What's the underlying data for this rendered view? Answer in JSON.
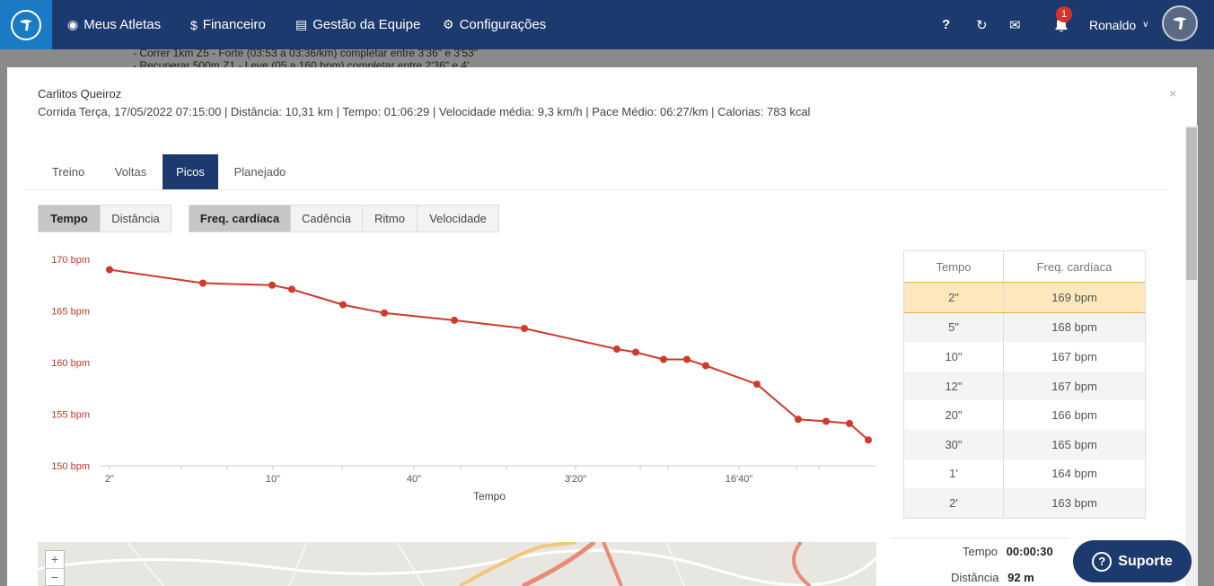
{
  "nav": {
    "items": [
      {
        "label": "Meus Atletas",
        "icon": "medal-icon"
      },
      {
        "label": "Financeiro",
        "icon": "dollar-icon"
      },
      {
        "label": "Gestão da Equipe",
        "icon": "id-card-icon"
      },
      {
        "label": "Configurações",
        "icon": "gears-icon"
      }
    ],
    "help": "?",
    "notifications": "1",
    "user": "Ronaldo"
  },
  "background_text": [
    "- Correr 1km Z5 - Forte (03:53 a 03:36/km) completar entre 3'36\" e 3'53\"",
    "- Recuperar 500m Z1 - Leve (05 a 160 bpm) completar entre 2'36\" e 4'"
  ],
  "modal": {
    "athlete": "Carlitos Queiroz",
    "summary": "Corrida Terça, 17/05/2022 07:15:00 | Distância: 10,31 km | Tempo: 01:06:29 | Velocidade média: 9,3 km/h | Pace Médio: 06:27/km | Calorias: 783 kcal",
    "close": "×",
    "tabs": [
      "Treino",
      "Voltas",
      "Picos",
      "Planejado"
    ],
    "active_tab": "Picos",
    "mode_buttons": [
      "Tempo",
      "Distância"
    ],
    "metric_buttons": [
      "Freq. cardíaca",
      "Cadência",
      "Ritmo",
      "Velocidade"
    ],
    "active_mode": "Tempo",
    "active_metric": "Freq. cardíaca"
  },
  "chart_data": {
    "type": "line",
    "xlabel": "Tempo",
    "ylabel": "",
    "y_ticks": [
      "150 bpm",
      "155 bpm",
      "160 bpm",
      "165 bpm",
      "170 bpm"
    ],
    "ylim": [
      150,
      170
    ],
    "x_tick_labels": [
      "2\"",
      "10\"",
      "40\"",
      "3'20\"",
      "16'40\""
    ],
    "series_color": "#d0392b",
    "series": [
      {
        "name": "",
        "values": [
          169,
          167.7,
          167.5,
          167.1,
          165.6,
          164.8,
          164.1,
          163.3,
          161.3,
          161.0,
          160.3,
          160.3,
          159.7,
          157.9,
          154.5,
          154.3,
          154.1,
          152.5
        ]
      }
    ]
  },
  "peaks_table": {
    "headers": [
      "Tempo",
      "Freq. cardíaca"
    ],
    "rows": [
      [
        "2\"",
        "169 bpm"
      ],
      [
        "5\"",
        "168 bpm"
      ],
      [
        "10\"",
        "167 bpm"
      ],
      [
        "12\"",
        "167 bpm"
      ],
      [
        "20\"",
        "166 bpm"
      ],
      [
        "30\"",
        "165 bpm"
      ],
      [
        "1'",
        "164 bpm"
      ],
      [
        "2'",
        "163 bpm"
      ]
    ]
  },
  "peak_info": {
    "tempo_label": "Tempo",
    "tempo_value": "00:00:30",
    "distancia_label": "Distância",
    "distancia_value": "92 m"
  },
  "map": {
    "zoom_in": "+",
    "zoom_out": "−"
  },
  "support": {
    "label": "Suporte"
  }
}
